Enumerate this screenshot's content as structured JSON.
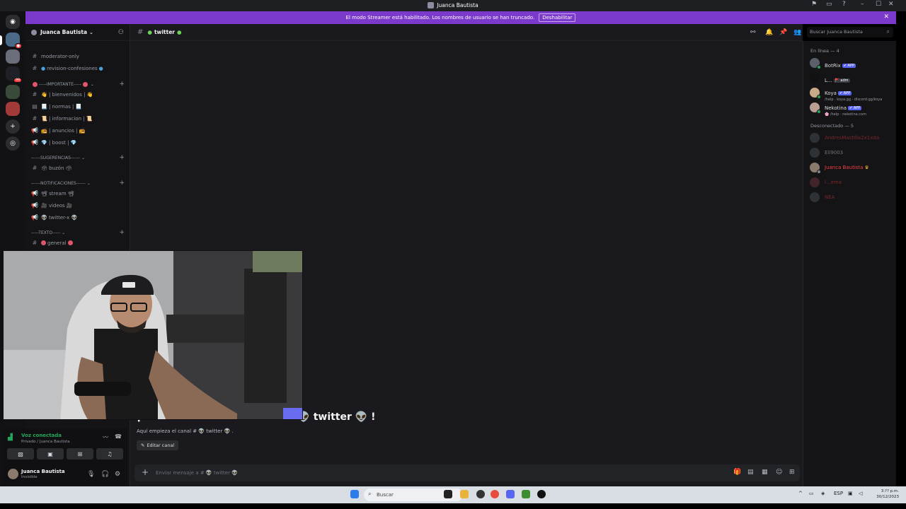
{
  "window": {
    "title": "Juanca Bautista"
  },
  "banner": {
    "text": "El modo Streamer está habilitado. Los nombres de usuario se han truncado.",
    "button": "Deshabilitar"
  },
  "sidebar": {
    "server_name": "Juanca Bautista",
    "channels": [
      {
        "icon": "#",
        "label": "moderator-only"
      },
      {
        "icon": "#",
        "label": "revision-confesiones"
      },
      {
        "icon": "#",
        "label": "👋 | bienvenidos | 👋"
      },
      {
        "icon": "▤",
        "label": "📃 | normas | 📃"
      },
      {
        "icon": "#",
        "label": "📜 | informacion | 📜"
      },
      {
        "icon": "📢",
        "label": "📻 | anuncios | 📻"
      },
      {
        "icon": "📢",
        "label": "💎 | boost | 💎"
      },
      {
        "icon": "#",
        "label": "🗳 buzón 🗳"
      },
      {
        "icon": "📢",
        "label": "📽 stream 📽"
      },
      {
        "icon": "📢",
        "label": "🎥 videos 🎥"
      },
      {
        "icon": "📢",
        "label": "👽 twitter-x 👽"
      },
      {
        "icon": "#",
        "label": "general"
      }
    ],
    "categories": [
      "-----IMPORTANTE-----",
      "------SUGERENCIAS------",
      "------NOTIFICACIONES------",
      "-----TEXTO-----"
    ]
  },
  "channel": {
    "name": "twitter"
  },
  "welcome": {
    "title": "¡Te damos la bienvenida a # 👽 twitter 👽 !",
    "subtitle": "Aquí empieza el canal # 👽 twitter 👽 .",
    "edit_button": "Editar canal"
  },
  "composer": {
    "placeholder": "Enviar mensaje a # 👽 twitter 👽"
  },
  "search": {
    "placeholder": "Buscar Juanca Bautista"
  },
  "members": {
    "online_header": "En línea — 4",
    "offline_header": "Desconectado — 5",
    "online": [
      {
        "name": "BotRix",
        "tag": "✔ APP",
        "sub": ""
      },
      {
        "name": "L...",
        "tag": "",
        "sub": ""
      },
      {
        "name": "Koya",
        "tag": "✔ APP",
        "sub": "/help · koya.gg · discord.gg/koya"
      },
      {
        "name": "Nekotina",
        "tag": "✔ APP",
        "sub": "🌸 /help · nekotina.com"
      }
    ],
    "offline": [
      {
        "name": "AndresMastilla2x1xda"
      },
      {
        "name": "Eli9003"
      },
      {
        "name": "Juanca Bautista"
      },
      {
        "name": "l...ema"
      },
      {
        "name": "NEA"
      }
    ],
    "badge_2": "🚩 adm"
  },
  "voice": {
    "status": "Voz conectada",
    "location": "Privado / Juanca Bautista"
  },
  "user": {
    "name": "Juanca Bautista",
    "status": "Invisible"
  },
  "taskbar": {
    "search": "Buscar",
    "lang": "ESP",
    "time": "3:?? p.m.",
    "date": "30/12/2023"
  },
  "colors": {
    "accent": "#7c3acd",
    "online": "#23a55a",
    "brand": "#5865f2",
    "owner": "#f23f42"
  }
}
